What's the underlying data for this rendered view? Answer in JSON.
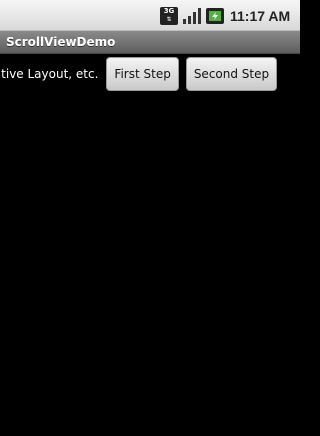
{
  "status_bar": {
    "network_label": "3G",
    "time": "11:17 AM",
    "icons": [
      "3g-icon",
      "signal-icon",
      "battery-icon"
    ]
  },
  "title_bar": {
    "title": "ScrollViewDemo"
  },
  "content": {
    "scroll_text": "out, Relative Layout, etc.",
    "buttons": [
      "First Step",
      "Second Step"
    ]
  },
  "colors": {
    "background": "#000000",
    "title_bar": "#6f6f6f",
    "status_bar": "#e6e6e6",
    "button": "#dedede"
  }
}
